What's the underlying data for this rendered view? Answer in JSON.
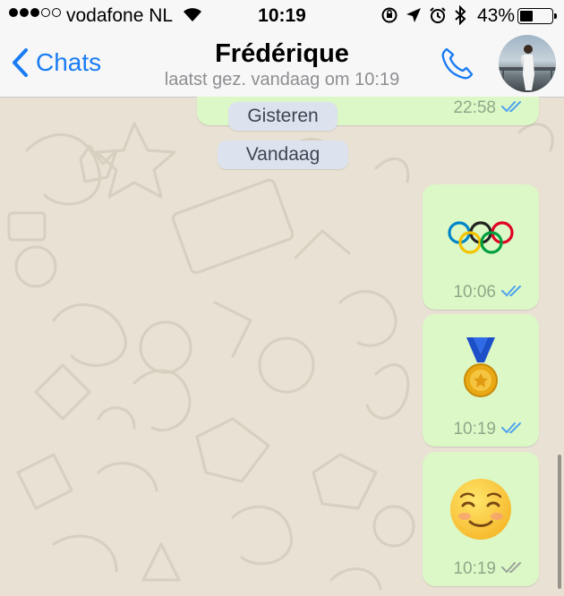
{
  "status_bar": {
    "carrier": "vodafone NL",
    "time": "10:19",
    "battery_percent": "43%",
    "battery_level": 0.43
  },
  "nav": {
    "back_label": "Chats",
    "contact_name": "Frédérique",
    "last_seen": "laatst gez. vandaag om 10:19"
  },
  "chat": {
    "previous_message_time": "22:58",
    "date_labels": [
      "Gisteren",
      "Vandaag"
    ],
    "messages": [
      {
        "emoji": "olympic-rings",
        "time": "10:06",
        "status": "read"
      },
      {
        "emoji": "sports-medal",
        "time": "10:19",
        "status": "read"
      },
      {
        "emoji": "smiling-face",
        "time": "10:19",
        "status": "delivered"
      }
    ]
  },
  "colors": {
    "accent": "#1a7cf4",
    "bubble_out": "#dcf8c6",
    "read_check": "#4fa3ef",
    "delivered_check": "#9aa39a",
    "chat_bg": "#e8e1d4"
  }
}
